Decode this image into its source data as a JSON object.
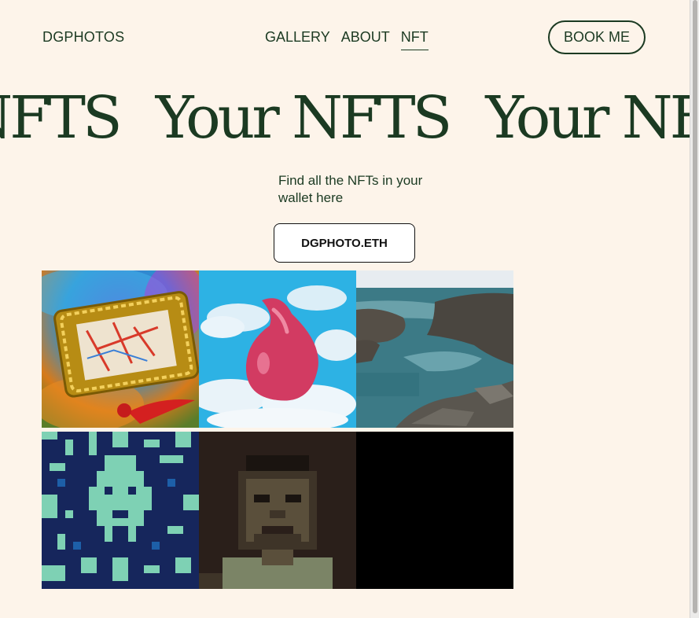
{
  "header": {
    "logo": "DGPHOTOS",
    "nav": [
      {
        "label": "GALLERY",
        "active": false
      },
      {
        "label": "ABOUT",
        "active": false
      },
      {
        "label": "NFT",
        "active": true
      }
    ],
    "book_button": "BOOK ME"
  },
  "hero": {
    "marquee_text": "Your NFTS",
    "subtitle": "Find all the NFTs in your wallet here",
    "wallet_button": "DGPHOTO.ETH"
  },
  "gallery": {
    "items": [
      {
        "name": "gilded-frame-art",
        "icon": "artwork-image"
      },
      {
        "name": "pink-drop-art",
        "icon": "artwork-image"
      },
      {
        "name": "rocky-coast-photo",
        "icon": "photo-image"
      },
      {
        "name": "pixel-skull-art",
        "icon": "pixel-art-image"
      },
      {
        "name": "pixel-portrait-art",
        "icon": "pixel-art-image"
      },
      {
        "name": "black-tile",
        "icon": "artwork-image"
      }
    ]
  },
  "colors": {
    "background": "#fdf4ea",
    "text": "#1b3a22"
  }
}
